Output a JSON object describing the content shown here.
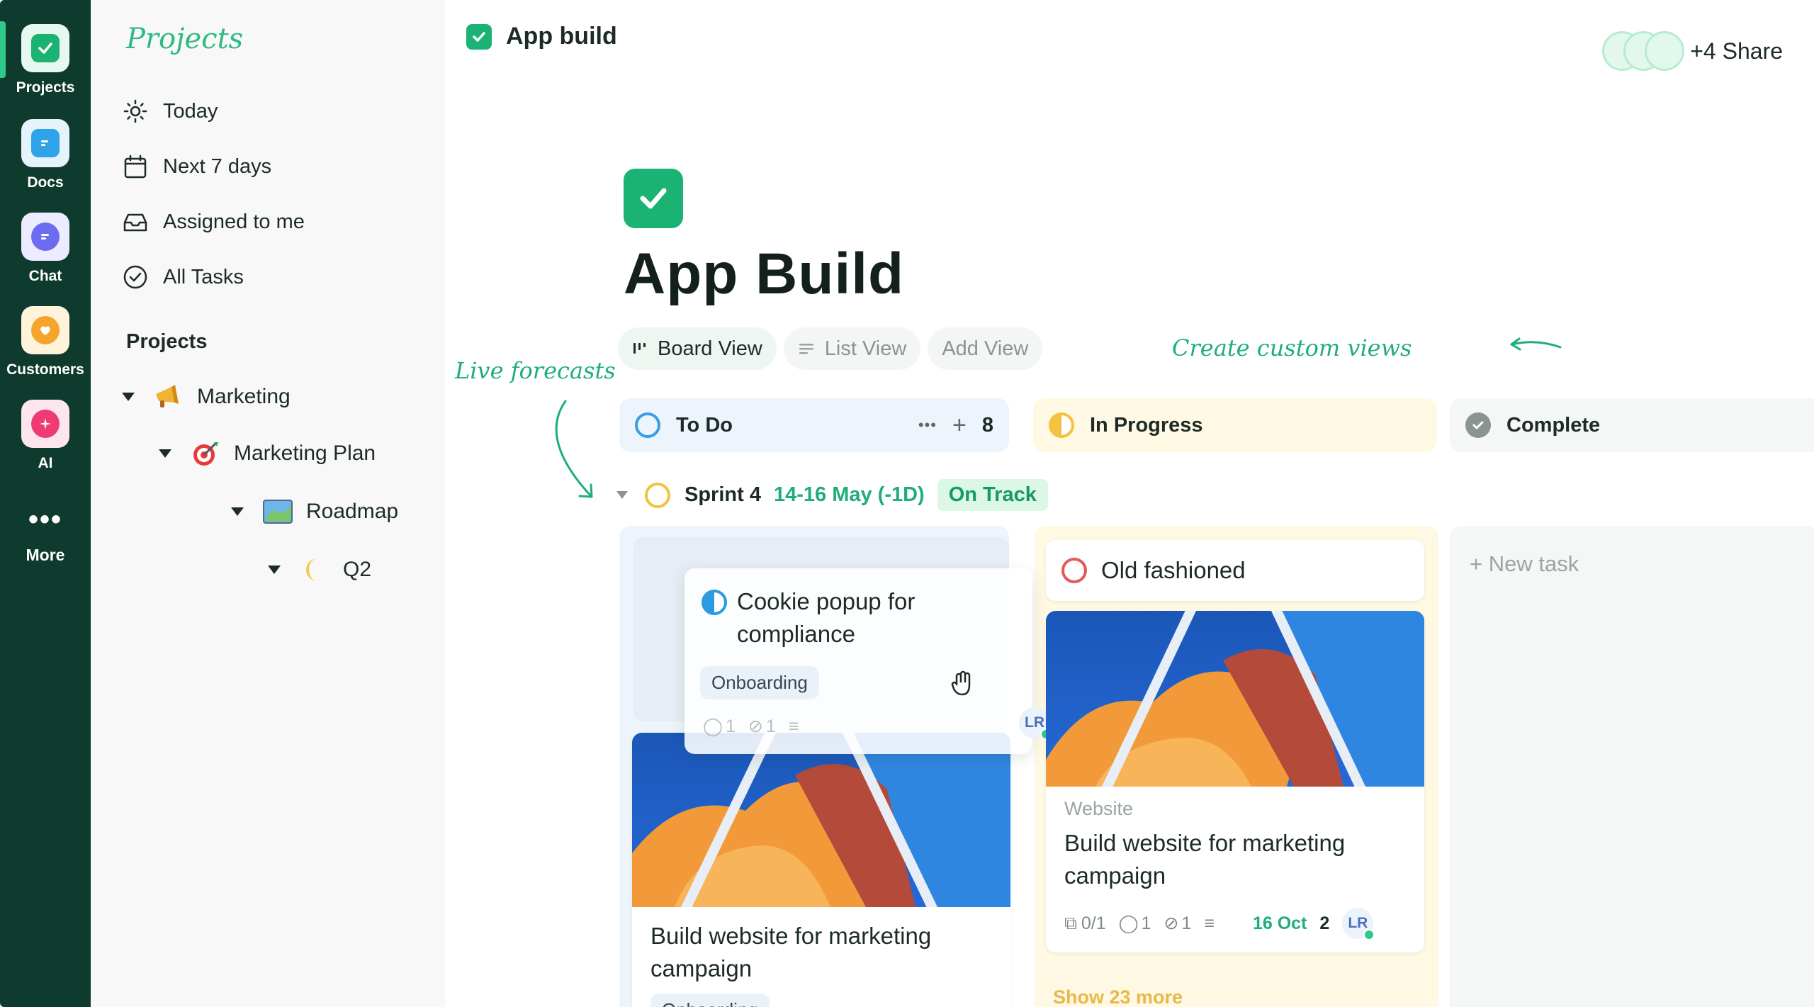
{
  "rail": {
    "items": [
      {
        "label": "Projects",
        "icon": "check-icon",
        "color": "#2fc98a"
      },
      {
        "label": "Docs",
        "icon": "doc-icon",
        "color": "#2ea3e8"
      },
      {
        "label": "Chat",
        "icon": "chat-icon",
        "color": "#6b6cf0"
      },
      {
        "label": "Customers",
        "icon": "heart-icon",
        "color": "#f4a52a"
      },
      {
        "label": "AI",
        "icon": "sparkle-icon",
        "color": "#ee3c73"
      },
      {
        "label": "More",
        "icon": "more-icon"
      }
    ]
  },
  "sidebar": {
    "title": "Projects",
    "nav": [
      {
        "label": "Today",
        "icon": "sun-icon"
      },
      {
        "label": "Next 7 days",
        "icon": "calendar-icon"
      },
      {
        "label": "Assigned to me",
        "icon": "inbox-icon"
      },
      {
        "label": "All Tasks",
        "icon": "check-circle-icon"
      }
    ],
    "section": "Projects",
    "tree": [
      {
        "label": "Marketing",
        "icon": "megaphone-icon"
      },
      {
        "label": "Marketing Plan",
        "icon": "target-icon"
      },
      {
        "label": "Roadmap",
        "icon": "map-icon"
      },
      {
        "label": "Q2",
        "icon": "moon-icon"
      }
    ]
  },
  "header": {
    "title": "App build",
    "share": "+4 Share"
  },
  "project": {
    "title": "App Build"
  },
  "views": {
    "board": "Board View",
    "list": "List View",
    "add": "Add View"
  },
  "annotations": {
    "custom_views": "Create custom views",
    "forecasts": "Live forecasts"
  },
  "columns": {
    "todo": {
      "label": "To Do",
      "count": "8",
      "more": "•••",
      "add": "+",
      "color": "#3a9ee6"
    },
    "progress": {
      "label": "In Progress",
      "color": "#f3c23e"
    },
    "complete": {
      "label": "Complete",
      "color": "#8a9590"
    }
  },
  "sprint": {
    "name": "Sprint 4",
    "dates": "14-16 May (-1D)",
    "status": "On Track"
  },
  "cards": {
    "dragging": {
      "title": "Cookie popup for compliance",
      "tag": "Onboarding",
      "comments": "1",
      "attachments": "1"
    },
    "todo_card": {
      "title": "Build website for marketing campaign",
      "tag": "Onboarding"
    },
    "old_fashioned": {
      "title": "Old fashioned"
    },
    "progress_card": {
      "category": "Website",
      "title": "Build website for marketing campaign",
      "subtasks": "0/1",
      "comments": "1",
      "attachments": "1",
      "date": "16 Oct",
      "priority": "2",
      "assignee": "LR"
    },
    "drag_assignee": "LR",
    "show_more": "Show 23 more",
    "new_task": "+ New task"
  }
}
